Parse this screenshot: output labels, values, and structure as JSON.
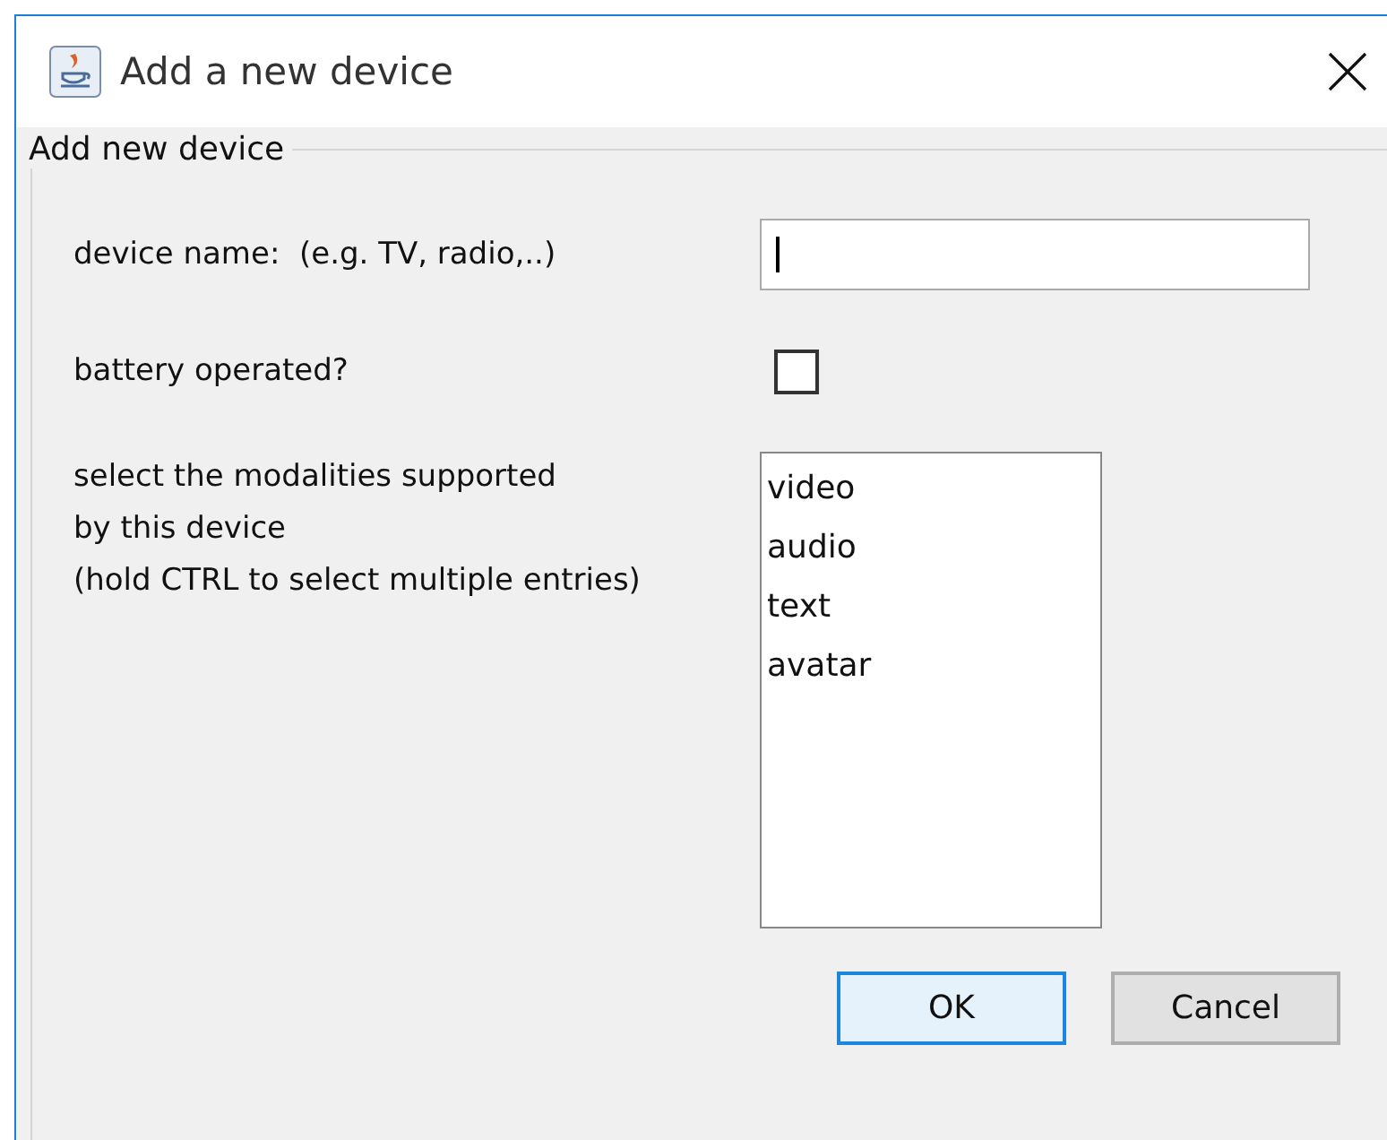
{
  "window": {
    "title": "Add a new device"
  },
  "group": {
    "title": "Add new device"
  },
  "name_field": {
    "label": "device name:  (e.g. TV, radio,..)",
    "focused": true
  },
  "battery": {
    "label": "battery operated?",
    "checked": false
  },
  "modalities": {
    "label_lines": [
      "select the modalities supported",
      "by this device",
      "(hold CTRL to select multiple entries)"
    ],
    "items": [
      {
        "label": "video",
        "selected": false
      },
      {
        "label": "audio",
        "selected": false
      },
      {
        "label": "text",
        "selected": false
      },
      {
        "label": "avatar",
        "selected": false
      }
    ]
  },
  "buttons": [
    {
      "label": "OK",
      "default": true
    },
    {
      "label": "Cancel",
      "default": false
    }
  ]
}
